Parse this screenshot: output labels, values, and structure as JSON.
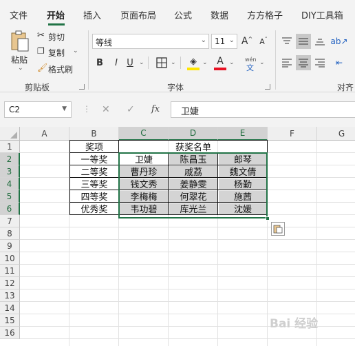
{
  "menu": {
    "items": [
      "文件",
      "开始",
      "插入",
      "页面布局",
      "公式",
      "数据",
      "方方格子",
      "DIY工具箱"
    ],
    "active_index": 1
  },
  "ribbon": {
    "clipboard": {
      "paste_label": "粘贴",
      "cut_label": "剪切",
      "copy_label": "复制",
      "format_painter_label": "格式刷",
      "group_label": "剪贴板"
    },
    "font": {
      "font_name": "等线",
      "font_size": "11",
      "bold": "B",
      "italic": "I",
      "underline": "U",
      "grow": "A",
      "shrink": "A",
      "wen_top": "wén",
      "wen_bottom": "文",
      "group_label": "字体",
      "underline_color": "#ffe600",
      "font_color": "#e81123"
    },
    "alignment": {
      "group_label": "对齐"
    }
  },
  "formula_bar": {
    "name_box": "C2",
    "fx": "fx",
    "cancel_icon": "✕",
    "enter_icon": "✓",
    "content": "卫婕"
  },
  "sheet": {
    "columns": [
      "A",
      "B",
      "C",
      "D",
      "E",
      "F",
      "G"
    ],
    "selected_columns": [
      "C",
      "D",
      "E"
    ],
    "rows": [
      "1",
      "2",
      "3",
      "4",
      "5",
      "6",
      "7",
      "8",
      "9",
      "10",
      "11",
      "12",
      "13",
      "14",
      "15",
      "16"
    ],
    "selected_rows": [
      "2",
      "3",
      "4",
      "5",
      "6"
    ],
    "header_b1": "奖项",
    "header_c1": "获奖名单",
    "awards": [
      "一等奖",
      "二等奖",
      "三等奖",
      "四等奖",
      "优秀奖"
    ],
    "names": [
      [
        "卫婕",
        "陈昌玉",
        "郎琴"
      ],
      [
        "曹丹珍",
        "戚荔",
        "魏文倩"
      ],
      [
        "钱文秀",
        "姜静雯",
        "杨勤"
      ],
      [
        "李梅梅",
        "何翠花",
        "施茜"
      ],
      [
        "韦功碧",
        "库光兰",
        "沈媛"
      ]
    ]
  },
  "watermark": "Bai 经验",
  "colors": {
    "accent": "#217346",
    "ribbon_bg": "#f3f3f3",
    "selection_shade": "#d4d4d4"
  }
}
